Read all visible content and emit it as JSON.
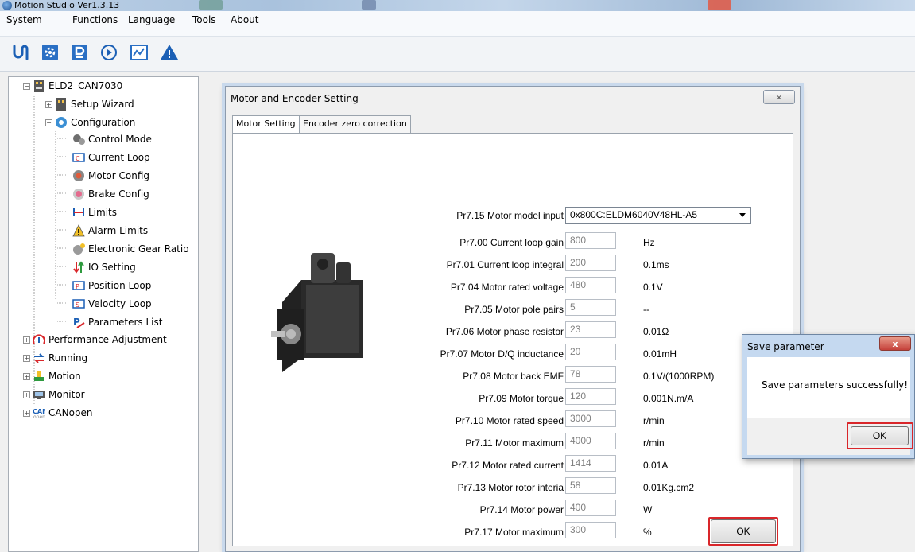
{
  "window": {
    "title": "Motion Studio Ver1.3.13"
  },
  "menu": [
    "System",
    "Functions",
    "Language",
    "Tools",
    "About"
  ],
  "toolbar": [
    "connect-icon",
    "settings-icon",
    "parameter-icon",
    "run-icon",
    "scope-icon",
    "alarm-icon"
  ],
  "tree": {
    "root": "ELD2_CAN7030",
    "items": [
      "Setup Wizard",
      "Configuration",
      "Control Mode",
      "Current Loop",
      "Motor Config",
      "Brake Config",
      "Limits",
      "Alarm Limits",
      "Electronic Gear Ratio",
      "IO Setting",
      "Position Loop",
      "Velocity Loop",
      "Parameters List",
      "Performance Adjustment",
      "Running",
      "Motion",
      "Monitor",
      "CANopen"
    ]
  },
  "dialog": {
    "title": "Motor and Encoder Setting",
    "close": "⨯",
    "tabs": [
      "Motor Setting",
      "Encoder zero correction"
    ],
    "model": {
      "label": "Pr7.15 Motor model input",
      "value": "0x800C:ELDM6040V48HL-A5"
    },
    "params": [
      {
        "label": "Pr7.00 Current loop gain",
        "value": "800",
        "unit": "Hz"
      },
      {
        "label": "Pr7.01 Current loop integral",
        "value": "200",
        "unit": "0.1ms"
      },
      {
        "label": "Pr7.04 Motor rated voltage",
        "value": "480",
        "unit": "0.1V"
      },
      {
        "label": "Pr7.05 Motor pole pairs",
        "value": "5",
        "unit": "--"
      },
      {
        "label": "Pr7.06 Motor phase resistor",
        "value": "23",
        "unit": "0.01Ω"
      },
      {
        "label": "Pr7.07 Motor D/Q inductance",
        "value": "20",
        "unit": "0.01mH"
      },
      {
        "label": "Pr7.08 Motor back EMF",
        "value": "78",
        "unit": "0.1V/(1000RPM)"
      },
      {
        "label": "Pr7.09 Motor torque",
        "value": "120",
        "unit": "0.001N.m/A"
      },
      {
        "label": "Pr7.10 Motor rated speed",
        "value": "3000",
        "unit": "r/min"
      },
      {
        "label": "Pr7.11 Motor maximum",
        "value": "4000",
        "unit": "r/min"
      },
      {
        "label": "Pr7.12 Motor rated current",
        "value": "1414",
        "unit": "0.01A"
      },
      {
        "label": "Pr7.13 Motor rotor interia",
        "value": "58",
        "unit": "0.01Kg.cm2"
      },
      {
        "label": "Pr7.14 Motor power",
        "value": "400",
        "unit": "W"
      },
      {
        "label": "Pr7.17 Motor maximum",
        "value": "300",
        "unit": "%"
      }
    ],
    "ok": "OK"
  },
  "popup": {
    "title": "Save parameter",
    "close": "x",
    "message": "Save parameters successfully!",
    "ok": "OK"
  },
  "colors": {
    "highlight": "#d9262a",
    "titlebar": "#bcd0e6"
  }
}
